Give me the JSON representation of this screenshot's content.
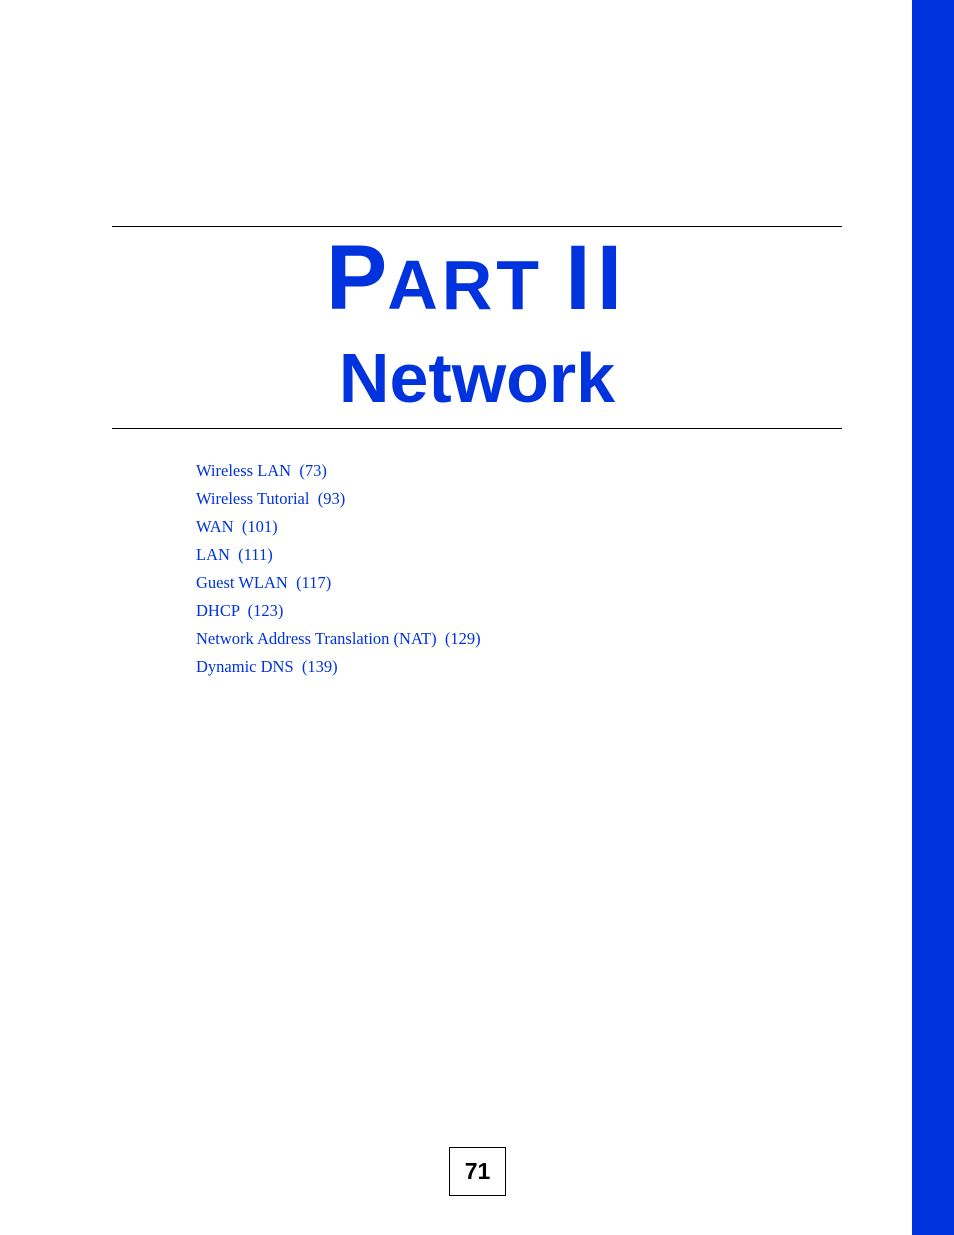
{
  "header": {
    "part_initial": "P",
    "part_rest": "ART",
    "part_number": "II",
    "title": "Network"
  },
  "toc": {
    "items": [
      {
        "title": "Wireless LAN",
        "page": "(73)"
      },
      {
        "title": "Wireless Tutorial",
        "page": "(93)"
      },
      {
        "title": "WAN",
        "page": "(101)"
      },
      {
        "title": "LAN",
        "page": "(111)"
      },
      {
        "title": "Guest WLAN",
        "page": "(117)"
      },
      {
        "title": "DHCP",
        "page": "(123)"
      },
      {
        "title": "Network Address Translation (NAT)",
        "page": "(129)"
      },
      {
        "title": "Dynamic DNS",
        "page": "(139)"
      }
    ]
  },
  "footer": {
    "page_number": "71"
  },
  "colors": {
    "accent": "#0033dd",
    "text": "#000000"
  }
}
